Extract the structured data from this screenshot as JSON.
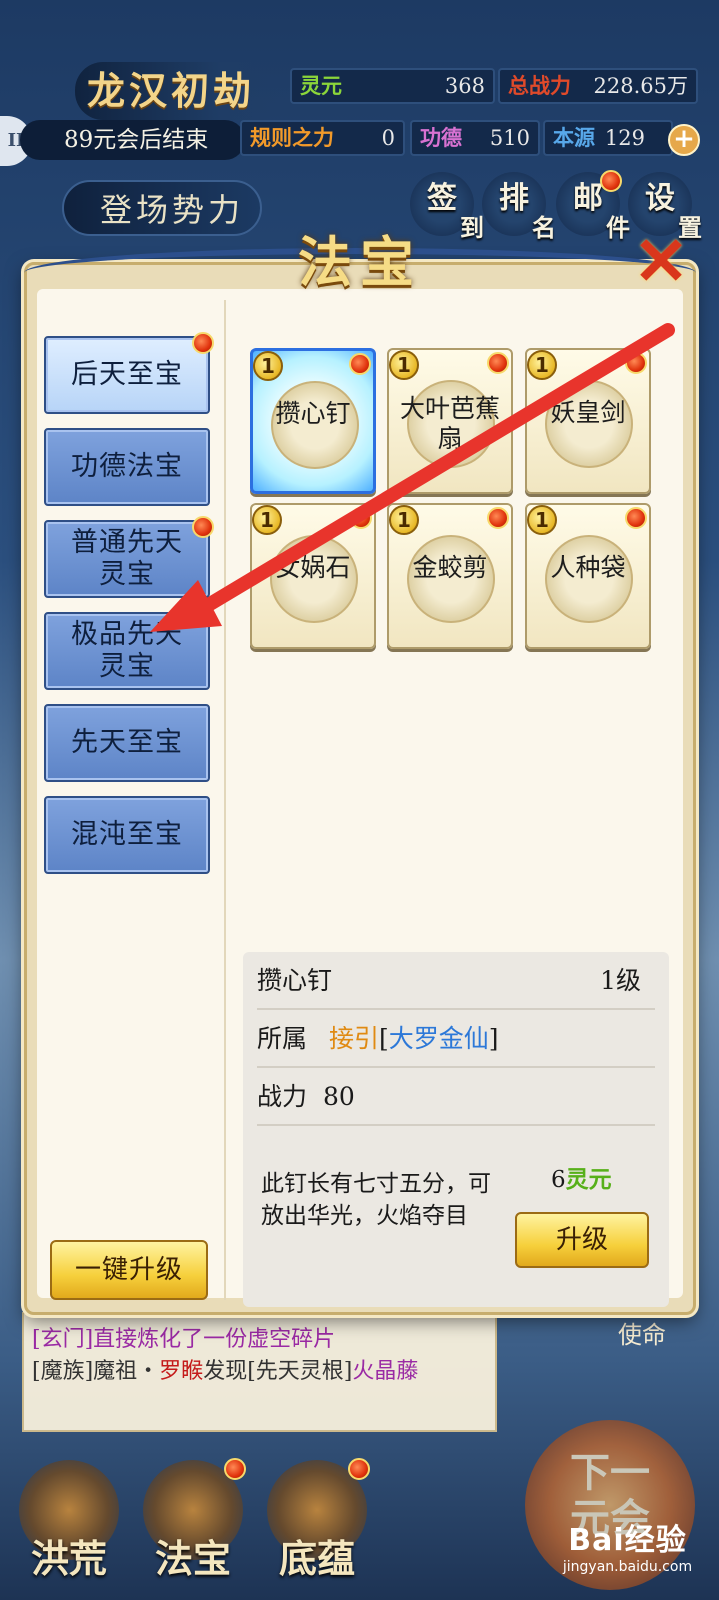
{
  "hud": {
    "game_title": "龙汉初劫",
    "countdown": "89元会后结束",
    "factions_button": "登场势力",
    "stats": {
      "lingyuan": {
        "label": "灵元",
        "value": "368"
      },
      "combat_power": {
        "label": "总战力",
        "value": "228.65万"
      },
      "rule_power": {
        "label": "规则之力",
        "value": "0"
      },
      "merit": {
        "label": "功德",
        "value": "510"
      },
      "origin": {
        "label": "本源",
        "value": "129"
      }
    },
    "top_menu": [
      {
        "main": "签",
        "sub": "到"
      },
      {
        "main": "排",
        "sub": "名"
      },
      {
        "main": "邮",
        "sub": "件"
      },
      {
        "main": "设",
        "sub": "置"
      }
    ]
  },
  "dialog": {
    "title": "法宝",
    "categories": [
      {
        "label": "后天至宝"
      },
      {
        "label": "功德法宝"
      },
      {
        "label": "普通先天灵宝"
      },
      {
        "label": "极品先天灵宝"
      },
      {
        "label": "先天至宝"
      },
      {
        "label": "混沌至宝"
      }
    ],
    "items": [
      {
        "name": "攒心钉",
        "level": "1"
      },
      {
        "name": "大叶芭蕉扇",
        "level": "1"
      },
      {
        "name": "妖皇剑",
        "level": "1"
      },
      {
        "name": "女娲石",
        "level": "1"
      },
      {
        "name": "金蛟剪",
        "level": "1"
      },
      {
        "name": "人种袋",
        "level": "1"
      }
    ],
    "one_click_upgrade": "一键升级",
    "detail": {
      "name": "攒心钉",
      "level": "1级",
      "owner_label": "所属",
      "owner_name": "接引",
      "owner_rank_open": "[",
      "owner_rank": "大罗金仙",
      "owner_rank_close": "]",
      "power_label": "战力",
      "power_value": "80",
      "description": "此钉长有七寸五分，可放出华光，火焰夺目",
      "cost_amount": "6",
      "cost_unit": "灵元",
      "upgrade_button": "升级"
    }
  },
  "log": {
    "line1": "[玄门]直接炼化了一份虚空碎片",
    "line2_prefix": "[魔族]魔祖・",
    "line2_name": "罗睺",
    "line2_mid": "发现[先天灵根]",
    "line2_item": "火晶藤"
  },
  "bottom_nav": [
    {
      "label": "洪荒"
    },
    {
      "label": "法宝"
    },
    {
      "label": "底蕴"
    }
  ],
  "next_era": {
    "line1": "下一",
    "line2": "元会"
  },
  "side_button_partial": "使命",
  "watermark": {
    "brand": "Bai经验",
    "url": "jingyan.baidu.com"
  },
  "colors": {
    "arrow": "#e8342c",
    "category_blue": "#6a8fd2",
    "gold_button": "#f6d03c"
  }
}
